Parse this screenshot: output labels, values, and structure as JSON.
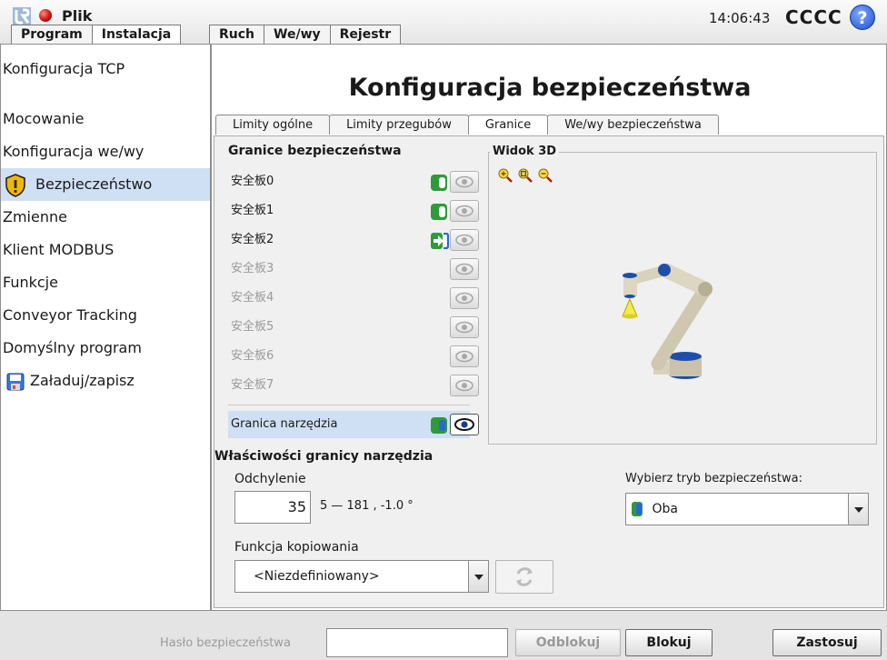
{
  "header": {
    "file_label": "Plik",
    "clock": "14:06:43",
    "robot_name": "CCCC",
    "help_icon": "?"
  },
  "main_tabs": [
    "Program",
    "Instalacja",
    "Ruch",
    "We/wy",
    "Rejestr"
  ],
  "sidebar": {
    "items": [
      {
        "label": "Konfiguracja TCP"
      },
      {
        "label": "Mocowanie"
      },
      {
        "label": "Konfiguracja we/wy"
      },
      {
        "label": "Bezpieczeństwo",
        "icon": "warning-shield-icon",
        "selected": true
      },
      {
        "label": "Zmienne"
      },
      {
        "label": "Klient MODBUS"
      },
      {
        "label": "Funkcje"
      },
      {
        "label": "Conveyor Tracking"
      },
      {
        "label": "Domyślny program"
      },
      {
        "label": "Załaduj/zapisz",
        "icon": "floppy-icon"
      }
    ]
  },
  "page": {
    "title": "Konfiguracja bezpieczeństwa",
    "tabs": [
      "Limity ogólne",
      "Limity przegubów",
      "Granice",
      "We/wy bezpieczeństwa"
    ],
    "active_tab": "Granice"
  },
  "boundaries": {
    "title": "Granice bezpieczeństwa",
    "rows": [
      {
        "label": "安全板0",
        "toggle": "enabled",
        "eye": "off"
      },
      {
        "label": "安全板1",
        "toggle": "enabled",
        "eye": "off"
      },
      {
        "label": "安全板2",
        "toggle": "trigger-arrow",
        "eye": "off"
      },
      {
        "label": "安全板3",
        "toggle": "none",
        "eye": "off"
      },
      {
        "label": "安全板4",
        "toggle": "none",
        "eye": "off"
      },
      {
        "label": "安全板5",
        "toggle": "none",
        "eye": "off"
      },
      {
        "label": "安全板6",
        "toggle": "none",
        "eye": "off"
      },
      {
        "label": "安全板7",
        "toggle": "none",
        "eye": "off"
      }
    ],
    "tool": {
      "label": "Granica narzędzia",
      "toggle": "enabled-blue",
      "eye": "on"
    }
  },
  "view3d": {
    "label": "Widok 3D",
    "zoom_icons": [
      "zoom-in-icon",
      "zoom-fit-icon",
      "zoom-out-icon"
    ]
  },
  "tool_props": {
    "title": "Właściwości granicy narzędzia",
    "deviation_label": "Odchylenie",
    "deviation_value": "35",
    "deviation_range": "5 — 181 , -1.0 °",
    "copy_label": "Funkcja kopiowania",
    "copy_value": "<Niezdefiniowany>",
    "mode_label": "Wybierz tryb bezpieczeństwa:",
    "mode_value": "Oba"
  },
  "footer": {
    "password_label": "Hasło bezpieczeństwa",
    "password_value": "",
    "unlock": "Odblokuj",
    "lock": "Blokuj",
    "apply": "Zastosuj"
  },
  "colors": {
    "toggle_green": "#2e9b3a",
    "selection": "#cfe0f4",
    "mode_blue": "#2a66d4"
  }
}
